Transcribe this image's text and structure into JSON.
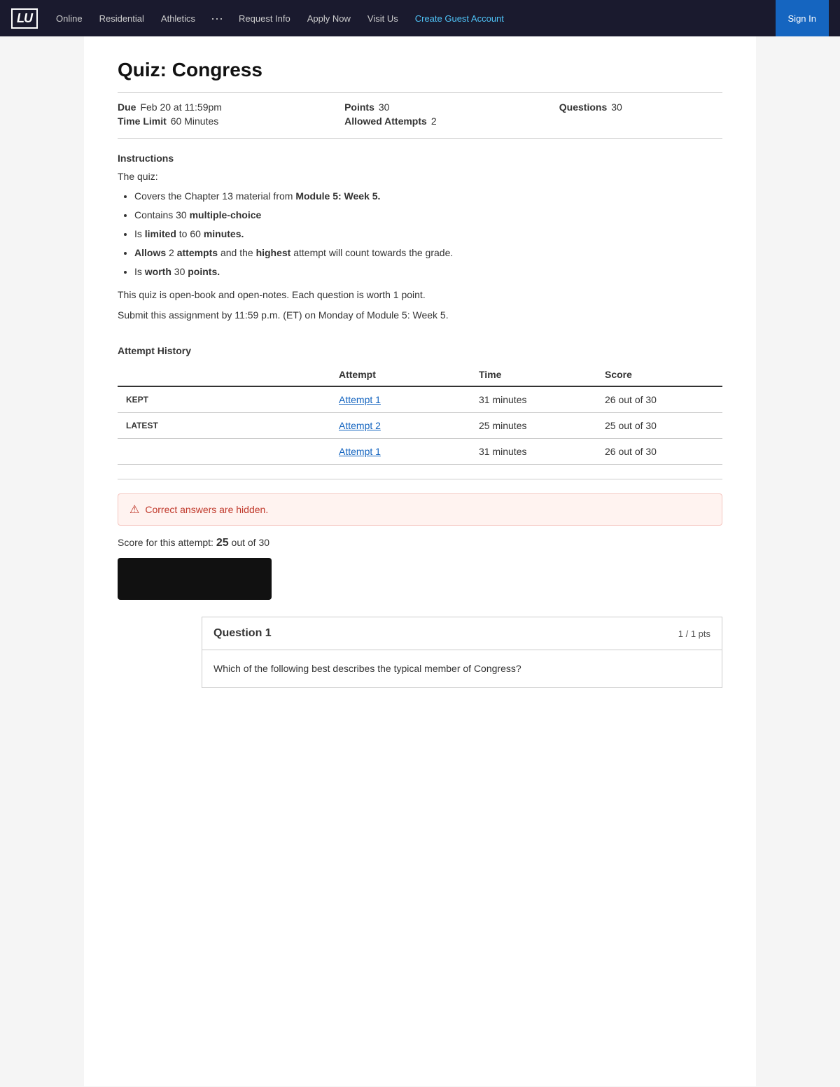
{
  "nav": {
    "logo": "LU",
    "links": [
      {
        "label": "Online",
        "id": "online"
      },
      {
        "label": "Residential",
        "id": "residential"
      },
      {
        "label": "Athletics",
        "id": "athletics"
      },
      {
        "label": "···",
        "id": "more"
      },
      {
        "label": "Request Info",
        "id": "request-info"
      },
      {
        "label": "Apply Now",
        "id": "apply-now"
      },
      {
        "label": "Visit Us",
        "id": "visit-us"
      },
      {
        "label": "Create Guest Account",
        "id": "create-guest",
        "blue": true
      }
    ],
    "signin_label": "Sign In"
  },
  "quiz": {
    "title": "Quiz: Congress",
    "due_label": "Due",
    "due_value": "Feb 20 at 11:59pm",
    "points_label": "Points",
    "points_value": "30",
    "questions_label": "Questions",
    "questions_value": "30",
    "time_limit_label": "Time Limit",
    "time_limit_value": "60 Minutes",
    "allowed_attempts_label": "Allowed Attempts",
    "allowed_attempts_value": "2"
  },
  "instructions": {
    "title": "Instructions",
    "intro": "The quiz:",
    "items": [
      {
        "html": "Covers the Chapter 13 material from <strong>Module 5: Week 5.</strong>"
      },
      {
        "html": "Contains 30 <strong>multiple-choice</strong>"
      },
      {
        "html": "Is <strong>limited</strong> to 60 <strong>minutes.</strong>"
      },
      {
        "html": "<strong>Allows</strong> 2 <strong>attempts</strong> and the <strong>highest</strong> attempt will count towards the grade."
      },
      {
        "html": "Is <strong>worth</strong> 30 <strong>points.</strong>"
      }
    ],
    "note1": "This quiz is open-book and open-notes.  Each question is worth 1 point.",
    "note2": "Submit this assignment by 11:59 p.m. (ET) on Monday of Module 5: Week 5."
  },
  "attempt_history": {
    "title": "Attempt History",
    "columns": [
      "",
      "Attempt",
      "Time",
      "Score"
    ],
    "rows": [
      {
        "label": "KEPT",
        "attempt": "Attempt 1",
        "time": "31 minutes",
        "score": "26 out of 30"
      },
      {
        "label": "LATEST",
        "attempt": "Attempt 2",
        "time": "25 minutes",
        "score": "25 out of 30"
      },
      {
        "label": "",
        "attempt": "Attempt 1",
        "time": "31 minutes",
        "score": "26 out of 30"
      }
    ]
  },
  "result": {
    "banner": "Correct answers are hidden.",
    "score_prefix": "Score for this attempt:",
    "score_value": "25",
    "score_suffix": "out of 30"
  },
  "question1": {
    "title": "Question 1",
    "pts": "1 / 1 pts",
    "body": "Which of the following best describes the typical member of Congress?"
  }
}
